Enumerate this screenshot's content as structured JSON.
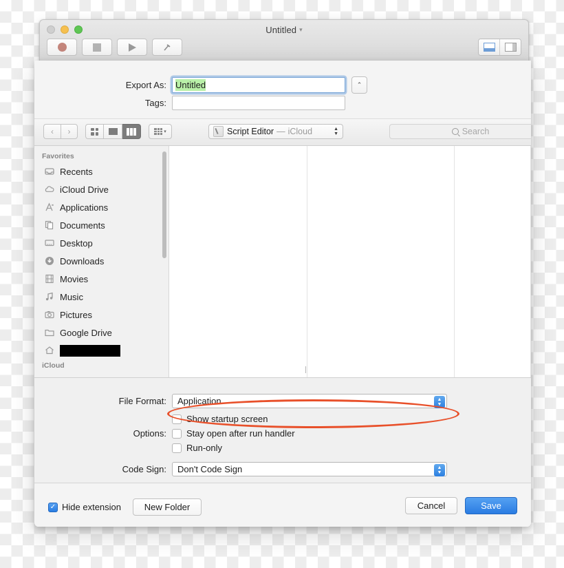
{
  "window": {
    "title": "Untitled",
    "title_chevron": "chevron-down",
    "traffic_lights": [
      "close",
      "minimize",
      "zoom"
    ],
    "toolbar_buttons": [
      {
        "name": "record",
        "icon": "record-circle-icon"
      },
      {
        "name": "stop",
        "icon": "stop-square-icon"
      },
      {
        "name": "run",
        "icon": "run-triangle-icon"
      },
      {
        "name": "compile",
        "icon": "hammer-icon"
      }
    ],
    "layout_segments": [
      {
        "name": "bottom-pane",
        "selected": true
      },
      {
        "name": "side-pane",
        "selected": false
      }
    ]
  },
  "sheet": {
    "export_as": {
      "label": "Export As:",
      "value": "Untitled",
      "selected": true
    },
    "tags": {
      "label": "Tags:",
      "value": "",
      "placeholder": ""
    },
    "expand_button_icon": "chevron-up-icon"
  },
  "navbar": {
    "back_icon": "chevron-left-icon",
    "forward_icon": "chevron-right-icon",
    "view_modes": [
      {
        "name": "icon-view",
        "active": false
      },
      {
        "name": "list-view",
        "active": false
      },
      {
        "name": "column-view",
        "active": true
      }
    ],
    "arrange": {
      "name": "arrange-by",
      "chevron": "chevron-down-icon"
    },
    "location": {
      "icon": "script-editor-icon",
      "name": "Script Editor",
      "separator": "—",
      "source": "iCloud"
    },
    "search": {
      "icon": "search-icon",
      "placeholder": "Search",
      "value": ""
    }
  },
  "sidebar": {
    "sections": [
      {
        "header": "Favorites",
        "items": [
          {
            "label": "Recents",
            "icon": "clock-tray-icon"
          },
          {
            "label": "iCloud Drive",
            "icon": "cloud-icon"
          },
          {
            "label": "Applications",
            "icon": "applications-icon"
          },
          {
            "label": "Documents",
            "icon": "documents-icon"
          },
          {
            "label": "Desktop",
            "icon": "desktop-icon"
          },
          {
            "label": "Downloads",
            "icon": "download-arrow-icon"
          },
          {
            "label": "Movies",
            "icon": "film-icon"
          },
          {
            "label": "Music",
            "icon": "music-note-icon"
          },
          {
            "label": "Pictures",
            "icon": "camera-icon"
          },
          {
            "label": "Google Drive",
            "icon": "folder-icon"
          },
          {
            "label": "",
            "icon": "home-icon",
            "redacted": true
          }
        ]
      },
      {
        "header": "iCloud",
        "items": []
      }
    ]
  },
  "browser": {
    "columns": [
      {
        "name": "column-1",
        "items": []
      },
      {
        "name": "column-2",
        "items": []
      },
      {
        "name": "column-3",
        "items": []
      }
    ]
  },
  "options_panel": {
    "file_format": {
      "label": "File Format:",
      "value": "Application"
    },
    "options": {
      "label": "Options:",
      "checkboxes": [
        {
          "label": "Show startup screen",
          "checked": false
        },
        {
          "label": "Stay open after run handler",
          "checked": false
        },
        {
          "label": "Run-only",
          "checked": false
        }
      ]
    },
    "code_sign": {
      "label": "Code Sign:",
      "value": "Don't Code Sign"
    }
  },
  "bottom_bar": {
    "hide_extension": {
      "label": "Hide extension",
      "checked": true,
      "check_glyph": "✓"
    },
    "new_folder_label": "New Folder",
    "cancel_label": "Cancel",
    "save_label": "Save"
  },
  "annotation": {
    "target": "file-format-popup",
    "color": "#e8502a",
    "shape": "ellipse"
  }
}
